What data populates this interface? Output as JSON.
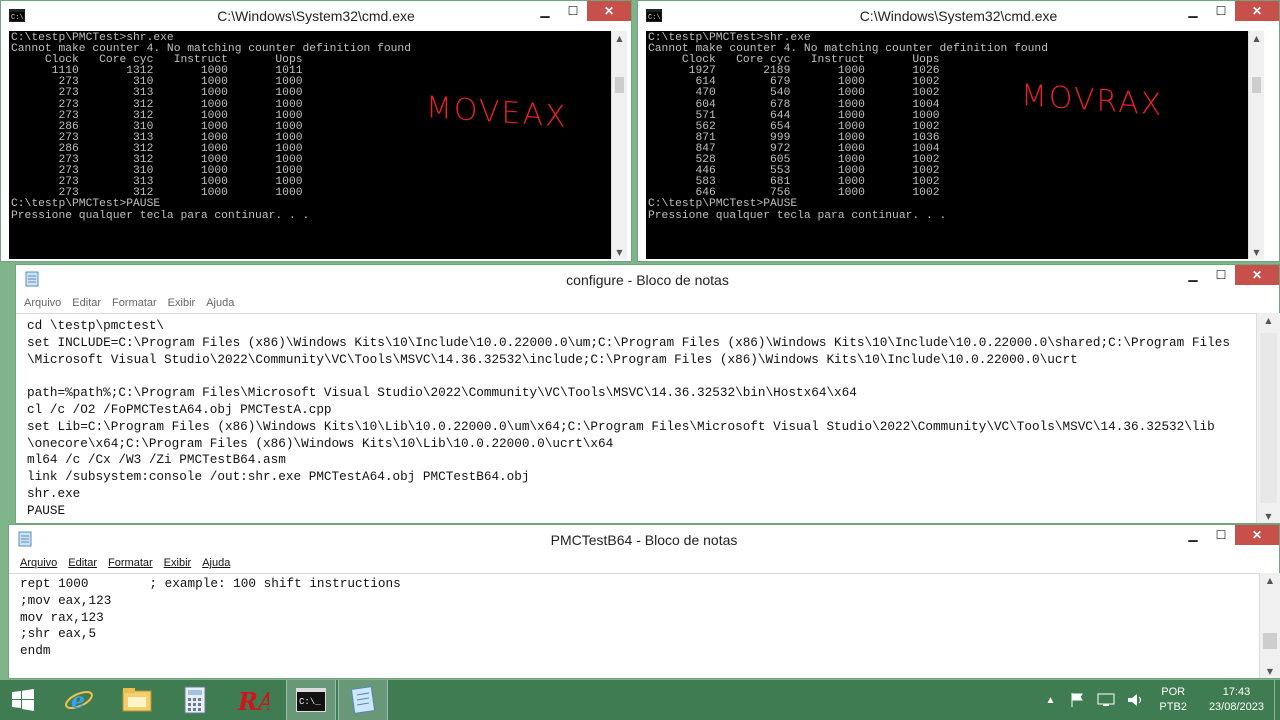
{
  "cmd_left": {
    "title": "C:\\Windows\\System32\\cmd.exe",
    "lines": [
      "C:\\testp\\PMCTest>shr.exe",
      "",
      "Cannot make counter 4. No matching counter definition found",
      "",
      "     Clock   Core cyc   Instruct       Uops",
      "      1110       1312       1000       1011",
      "       273        310       1000       1000",
      "       273        313       1000       1000",
      "       273        312       1000       1000",
      "       273        312       1000       1000",
      "       286        310       1000       1000",
      "       273        313       1000       1000",
      "       286        312       1000       1000",
      "       273        312       1000       1000",
      "       273        310       1000       1000",
      "       273        313       1000       1000",
      "       273        312       1000       1000",
      "",
      "C:\\testp\\PMCTest>PAUSE",
      "Pressione qualquer tecla para continuar. . ."
    ],
    "annotation": "MOVEAX"
  },
  "cmd_right": {
    "title": "C:\\Windows\\System32\\cmd.exe",
    "lines": [
      "C:\\testp\\PMCTest>shr.exe",
      "",
      "Cannot make counter 4. No matching counter definition found",
      "",
      "     Clock   Core cyc   Instruct       Uops",
      "      1927       2189       1000       1026",
      "       614        679       1000       1002",
      "       470        540       1000       1002",
      "       604        678       1000       1004",
      "       571        644       1000       1000",
      "       562        654       1000       1002",
      "       871        999       1000       1036",
      "       847        972       1000       1004",
      "       528        605       1000       1002",
      "       446        553       1000       1002",
      "       583        681       1000       1002",
      "       646        756       1000       1002",
      "",
      "C:\\testp\\PMCTest>PAUSE",
      "Pressione qualquer tecla para continuar. . ."
    ],
    "annotation": "MOVRAX"
  },
  "notepad_configure": {
    "title": "configure - Bloco de notas",
    "menu": [
      "Arquivo",
      "Editar",
      "Formatar",
      "Exibir",
      "Ajuda"
    ],
    "lines": [
      "cd \\testp\\pmctest\\",
      "set INCLUDE=C:\\Program Files (x86)\\Windows Kits\\10\\Include\\10.0.22000.0\\um;C:\\Program Files (x86)\\Windows Kits\\10\\Include\\10.0.22000.0\\shared;C:\\Program Files",
      "\\Microsoft Visual Studio\\2022\\Community\\VC\\Tools\\MSVC\\14.36.32532\\include;C:\\Program Files (x86)\\Windows Kits\\10\\Include\\10.0.22000.0\\ucrt",
      "",
      "path=%path%;C:\\Program Files\\Microsoft Visual Studio\\2022\\Community\\VC\\Tools\\MSVC\\14.36.32532\\bin\\Hostx64\\x64",
      "cl /c /O2 /FoPMCTestA64.obj PMCTestA.cpp",
      "set Lib=C:\\Program Files (x86)\\Windows Kits\\10\\Lib\\10.0.22000.0\\um\\x64;C:\\Program Files\\Microsoft Visual Studio\\2022\\Community\\VC\\Tools\\MSVC\\14.36.32532\\lib",
      "\\onecore\\x64;C:\\Program Files (x86)\\Windows Kits\\10\\Lib\\10.0.22000.0\\ucrt\\x64",
      "ml64 /c /Cx /W3 /Zi PMCTestB64.asm",
      "link /subsystem:console /out:shr.exe PMCTestA64.obj PMCTestB64.obj",
      "shr.exe",
      "PAUSE"
    ]
  },
  "notepad_b64": {
    "title": "PMCTestB64 - Bloco de notas",
    "menu": [
      "Arquivo",
      "Editar",
      "Formatar",
      "Exibir",
      "Ajuda"
    ],
    "lines": [
      "rept 1000        ; example: 100 shift instructions",
      ";mov eax,123",
      "mov rax,123",
      ";shr eax,5",
      "endm"
    ]
  },
  "taskbar": {
    "items": [
      "start-button",
      "internet-explorer-icon",
      "file-explorer-icon",
      "calculator-icon",
      "ra-app-icon",
      "cmd-icon",
      "notepad-icon"
    ],
    "language_top": "POR",
    "language_bottom": "PTB2",
    "time": "17:43",
    "date": "23/08/2023"
  }
}
